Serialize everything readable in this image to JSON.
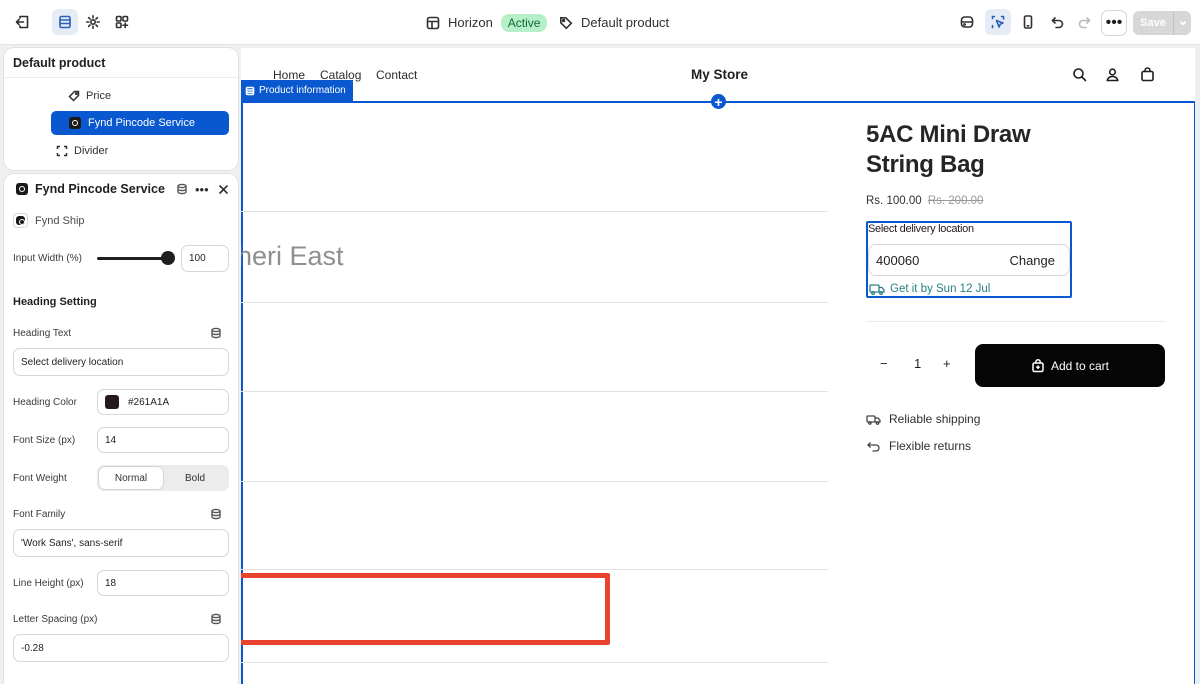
{
  "topbar": {
    "theme_name": "Horizon",
    "theme_status": "Active",
    "page_name": "Default product",
    "more_label": "•••",
    "save_label": "Save"
  },
  "tree": {
    "title": "Default product",
    "items": [
      {
        "label": "Price",
        "icon": "price-tag-icon"
      },
      {
        "label": "Fynd Pincode Service",
        "icon": "app-icon"
      },
      {
        "label": "Divider",
        "icon": "divider-icon"
      }
    ]
  },
  "settings": {
    "title": "Fynd Pincode Service",
    "app_name": "Fynd Ship",
    "input_width_label": "Input Width (%)",
    "input_width_value": "100",
    "input_width_slider_fraction": 1.0,
    "heading_setting_title": "Heading Setting",
    "heading_text_label": "Heading Text",
    "heading_text_value": "Select delivery location",
    "heading_color_label": "Heading Color",
    "heading_color_value": "#261A1A",
    "font_size_label": "Font Size (px)",
    "font_size_value": "14",
    "font_weight_label": "Font Weight",
    "font_weight_options": [
      "Normal",
      "Bold"
    ],
    "font_weight_selected": "Normal",
    "font_family_label": "Font Family",
    "font_family_value": "'Work Sans', sans-serif",
    "line_height_label": "Line Height (px)",
    "line_height_value": "18",
    "letter_spacing_label": "Letter Spacing (px)",
    "letter_spacing_value": "-0.28"
  },
  "store": {
    "nav": [
      "Home",
      "Catalog",
      "Contact"
    ],
    "title": "My Store",
    "section_tag": "Product information",
    "ghost_text": "heri East",
    "product_title": "5AC Mini Draw String Bag",
    "price": "Rs. 100.00",
    "compare_price": "Rs. 200.00",
    "pincode": {
      "heading": "Select delivery location",
      "value": "400060",
      "change_label": "Change",
      "eta": "Get it by Sun 12 Jul"
    },
    "quantity": "1",
    "qty_minus": "−",
    "qty_plus": "+",
    "add_to_cart": "Add to cart",
    "features": [
      "Reliable shipping",
      "Flexible returns"
    ]
  },
  "colors": {
    "accent": "#0a58d0",
    "eta_text": "#2a7f86",
    "highlight_box": "#e8432e",
    "status_badge_bg": "#b7f0c8"
  }
}
